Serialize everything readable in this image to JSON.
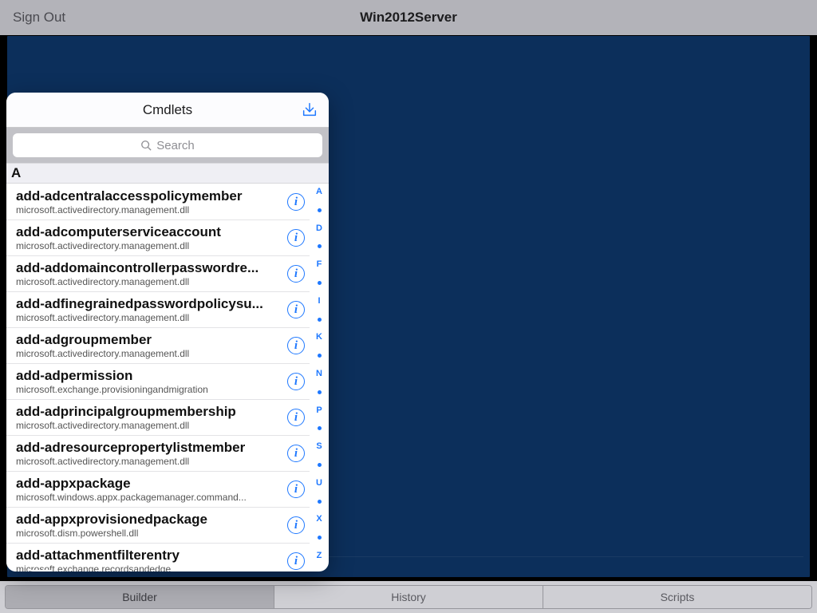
{
  "top": {
    "signout": "Sign Out",
    "title": "Win2012Server"
  },
  "tabs": {
    "builder": "Builder",
    "history": "History",
    "scripts": "Scripts",
    "active": "builder"
  },
  "popover": {
    "title": "Cmdlets",
    "search_placeholder": "Search",
    "section": "A",
    "index": [
      "A",
      "•",
      "D",
      "•",
      "F",
      "•",
      "I",
      "•",
      "K",
      "•",
      "N",
      "•",
      "P",
      "•",
      "S",
      "•",
      "U",
      "•",
      "X",
      "•",
      "Z"
    ],
    "items": [
      {
        "title": "add-adcentralaccesspolicymember",
        "sub": "microsoft.activedirectory.management.dll"
      },
      {
        "title": "add-adcomputerserviceaccount",
        "sub": "microsoft.activedirectory.management.dll"
      },
      {
        "title": "add-addomaincontrollerpasswordre...",
        "sub": "microsoft.activedirectory.management.dll"
      },
      {
        "title": "add-adfinegrainedpasswordpolicysu...",
        "sub": "microsoft.activedirectory.management.dll"
      },
      {
        "title": "add-adgroupmember",
        "sub": "microsoft.activedirectory.management.dll"
      },
      {
        "title": "add-adpermission",
        "sub": "microsoft.exchange.provisioningandmigration"
      },
      {
        "title": "add-adprincipalgroupmembership",
        "sub": "microsoft.activedirectory.management.dll"
      },
      {
        "title": "add-adresourcepropertylistmember",
        "sub": "microsoft.activedirectory.management.dll"
      },
      {
        "title": "add-appxpackage",
        "sub": "microsoft.windows.appx.packagemanager.command..."
      },
      {
        "title": "add-appxprovisionedpackage",
        "sub": "microsoft.dism.powershell.dll"
      },
      {
        "title": "add-attachmentfilterentry",
        "sub": "microsoft.exchange.recordsandedge"
      }
    ]
  }
}
